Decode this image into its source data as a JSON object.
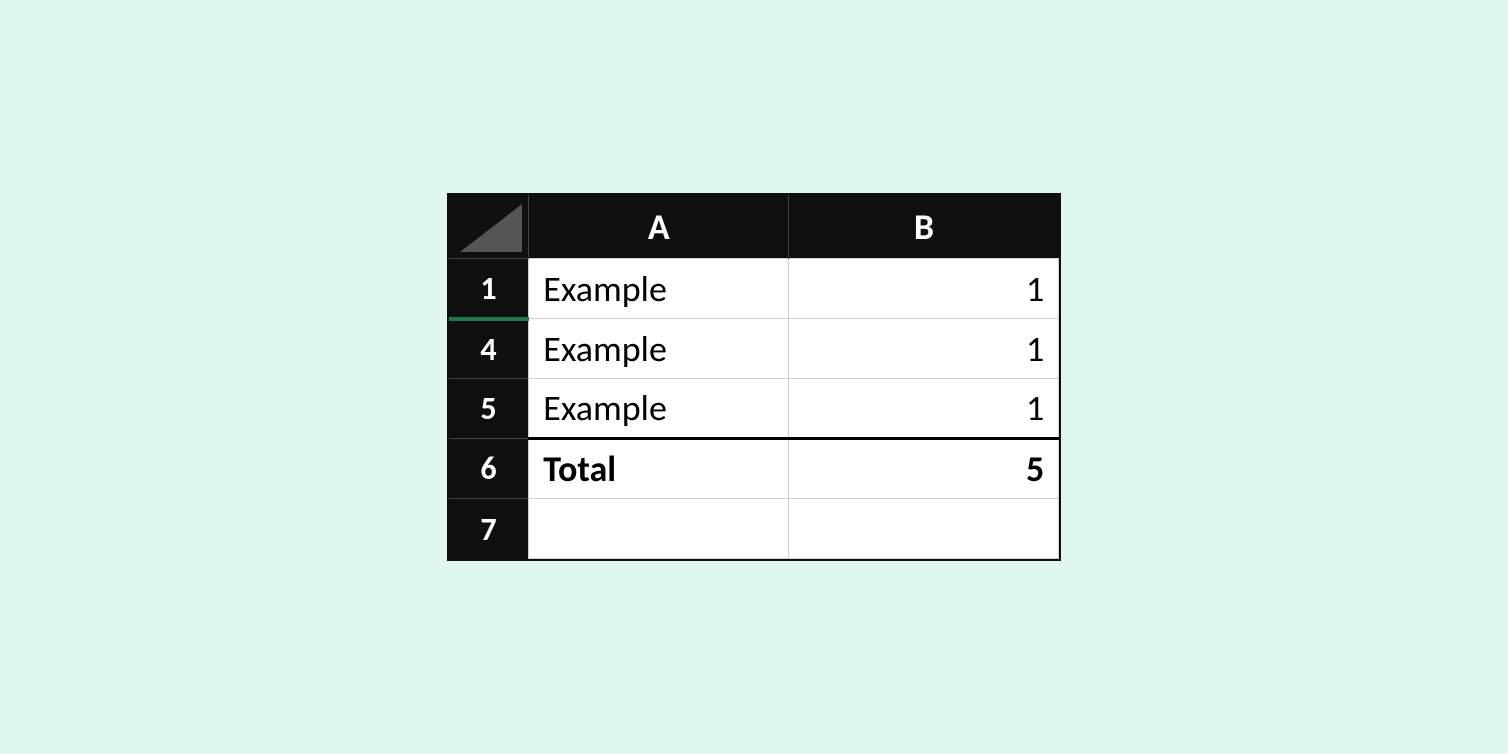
{
  "columns": [
    "A",
    "B"
  ],
  "rows": [
    {
      "num": "1",
      "a": "Example",
      "b": "1",
      "active": true
    },
    {
      "num": "4",
      "a": "Example",
      "b": "1"
    },
    {
      "num": "5",
      "a": "Example",
      "b": "1"
    },
    {
      "num": "6",
      "a": "Total",
      "b": "5",
      "total": true
    },
    {
      "num": "7",
      "a": "",
      "b": "",
      "empty": true
    }
  ]
}
